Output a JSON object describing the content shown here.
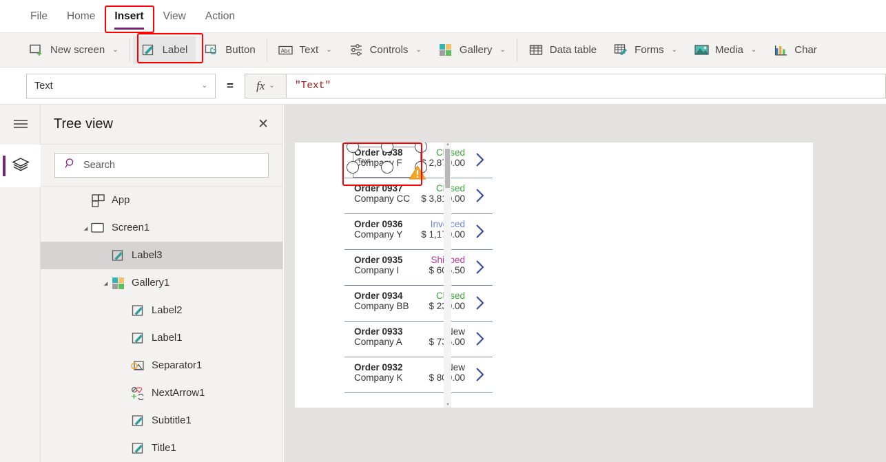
{
  "menubar": {
    "tabs": [
      {
        "label": "File",
        "active": false
      },
      {
        "label": "Home",
        "active": false
      },
      {
        "label": "Insert",
        "active": true
      },
      {
        "label": "View",
        "active": false
      },
      {
        "label": "Action",
        "active": false
      }
    ]
  },
  "ribbon": {
    "items": [
      {
        "label": "New screen",
        "icon": "new-screen-icon",
        "caret": "⌄",
        "highlighted": false
      },
      {
        "label": "Label",
        "icon": "label-icon",
        "caret": "",
        "highlighted": true
      },
      {
        "label": "Button",
        "icon": "button-icon",
        "caret": "",
        "highlighted": false
      },
      {
        "label": "Text",
        "icon": "text-abc-icon",
        "caret": "⌄",
        "highlighted": false
      },
      {
        "label": "Controls",
        "icon": "controls-sliders-icon",
        "caret": "⌄",
        "highlighted": false
      },
      {
        "label": "Gallery",
        "icon": "gallery-icon",
        "caret": "⌄",
        "highlighted": false
      },
      {
        "label": "Data table",
        "icon": "data-table-icon",
        "caret": "",
        "highlighted": false
      },
      {
        "label": "Forms",
        "icon": "forms-icon",
        "caret": "⌄",
        "highlighted": false
      },
      {
        "label": "Media",
        "icon": "media-image-icon",
        "caret": "⌄",
        "highlighted": false
      },
      {
        "label": "Char",
        "icon": "charts-icon",
        "caret": "",
        "highlighted": false
      }
    ]
  },
  "formulabar": {
    "property": "Text",
    "equals": "=",
    "fx_label": "fx",
    "fx_caret": "⌄",
    "formula": "\"Text\"",
    "property_caret": "⌄"
  },
  "rail": {
    "hamburger": "hamburger-menu-icon",
    "active_tool": "tree-view-layers-icon"
  },
  "treeview": {
    "title": "Tree view",
    "close": "✕",
    "search_placeholder": "Search",
    "items": [
      {
        "label": "App",
        "icon": "app-icon",
        "level": 0,
        "caret": "",
        "selected": false
      },
      {
        "label": "Screen1",
        "icon": "screen-icon",
        "level": 1,
        "caret": "◢",
        "selected": false
      },
      {
        "label": "Label3",
        "icon": "label-icon",
        "level": 2,
        "caret": "",
        "selected": true
      },
      {
        "label": "Gallery1",
        "icon": "gallery-icon",
        "level": 2,
        "caret": "◢",
        "selected": false
      },
      {
        "label": "Label2",
        "icon": "label-icon",
        "level": 3,
        "caret": "",
        "selected": false
      },
      {
        "label": "Label1",
        "icon": "label-icon",
        "level": 3,
        "caret": "",
        "selected": false
      },
      {
        "label": "Separator1",
        "icon": "separator-image-icon",
        "level": 3,
        "caret": "",
        "selected": false
      },
      {
        "label": "NextArrow1",
        "icon": "icons-group-icon",
        "level": 3,
        "caret": "",
        "selected": false
      },
      {
        "label": "Subtitle1",
        "icon": "label-icon",
        "level": 3,
        "caret": "",
        "selected": false
      },
      {
        "label": "Title1",
        "icon": "label-icon",
        "level": 3,
        "caret": "",
        "selected": false
      }
    ]
  },
  "canvas": {
    "selected_control": {
      "name": "Label3",
      "text": "Text",
      "warning": "warning-triangle-icon"
    },
    "gallery": {
      "items": [
        {
          "order": "Order 0938",
          "company": "Company F",
          "status": "Closed",
          "amount": "$ 2,870.00"
        },
        {
          "order": "Order 0937",
          "company": "Company CC",
          "status": "Closed",
          "amount": "$ 3,810.00"
        },
        {
          "order": "Order 0936",
          "company": "Company Y",
          "status": "Invoiced",
          "amount": "$ 1,170.00"
        },
        {
          "order": "Order 0935",
          "company": "Company I",
          "status": "Shipped",
          "amount": "$ 606.50"
        },
        {
          "order": "Order 0934",
          "company": "Company BB",
          "status": "Closed",
          "amount": "$ 230.00"
        },
        {
          "order": "Order 0933",
          "company": "Company A",
          "status": "New",
          "amount": "$ 736.00"
        },
        {
          "order": "Order 0932",
          "company": "Company K",
          "status": "New",
          "amount": "$ 800.00"
        }
      ]
    }
  },
  "colors": {
    "accent_purple": "#742774",
    "status_closed": "#3aa33a",
    "status_invoiced": "#6b7fd7",
    "status_shipped": "#b5379b",
    "status_new": "#3b3b3b",
    "annotation_red": "#ff0000",
    "chevron_blue": "#3b4f9e",
    "warning_orange": "#f5a623"
  }
}
